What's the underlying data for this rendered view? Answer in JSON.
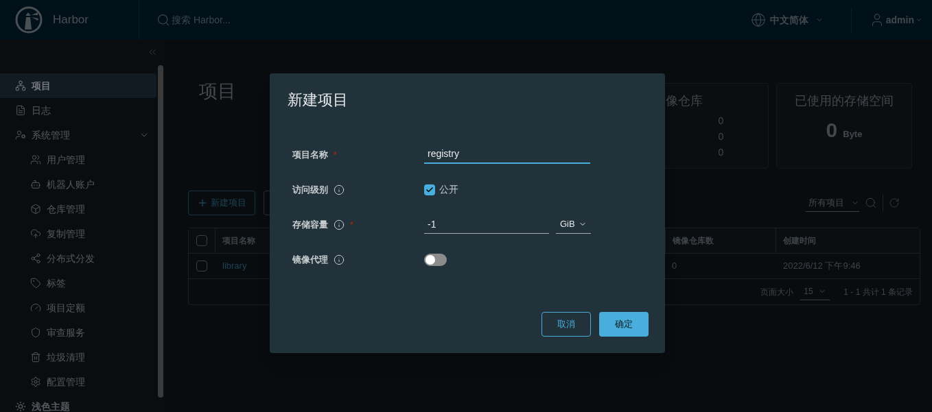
{
  "header": {
    "brand": "Harbor",
    "search": {
      "placeholder": "搜索 Harbor..."
    },
    "language": "中文简体",
    "user": "admin"
  },
  "sidebar": {
    "items": [
      {
        "label": "项目",
        "selected": true
      },
      {
        "label": "日志",
        "selected": false
      },
      {
        "label": "系统管理",
        "selected": false,
        "expanded": true,
        "children": [
          {
            "label": "用户管理",
            "selected": false
          },
          {
            "label": "机器人账户",
            "selected": false
          },
          {
            "label": "仓库管理",
            "selected": false
          },
          {
            "label": "复制管理",
            "selected": false
          },
          {
            "label": "分布式分发",
            "selected": false
          },
          {
            "label": "标签",
            "selected": false
          },
          {
            "label": "项目定额",
            "selected": false
          },
          {
            "label": "审查服务",
            "selected": false
          },
          {
            "label": "垃圾清理",
            "selected": false
          },
          {
            "label": "配置管理",
            "selected": false
          }
        ]
      }
    ],
    "theme_toggle": "浅色主题"
  },
  "page": {
    "title": "项目",
    "cards": [
      {
        "kind": "counts",
        "title": "像仓库",
        "values": [
          "0",
          "0",
          "0"
        ]
      },
      {
        "kind": "storage",
        "title": "已使用的存储空间",
        "value": "0",
        "unit": "Byte"
      }
    ],
    "toolbar": {
      "new_button": "新建项目",
      "filter": "所有项目"
    },
    "table": {
      "header_checked": false,
      "columns": [
        "项目名称",
        "镜像仓库数",
        "创建时间"
      ],
      "rows": [
        {
          "checked": false,
          "name": "library",
          "repo_count": "0",
          "created": "2022/6/12 下午9:46"
        }
      ],
      "footer": {
        "page_size_label": "页面大小",
        "page_size": "15",
        "summary": "1 - 1 共计 1 条记录"
      }
    }
  },
  "dialog": {
    "title": "新建项目",
    "fields": [
      {
        "kind": "text",
        "label": "项目名称",
        "required": true,
        "info": false,
        "value": "registry",
        "focused": true
      },
      {
        "kind": "checkbox",
        "label": "访问级别",
        "required": false,
        "info": true,
        "checked": true,
        "option": "公开"
      },
      {
        "kind": "quota",
        "label": "存储容量",
        "required": true,
        "info": true,
        "value": "-1",
        "unit": "GiB",
        "focused": false
      },
      {
        "kind": "toggle",
        "label": "镜像代理",
        "required": false,
        "info": true,
        "on": false
      }
    ],
    "required_mark": "*",
    "cancel": "取消",
    "ok": "确定"
  }
}
